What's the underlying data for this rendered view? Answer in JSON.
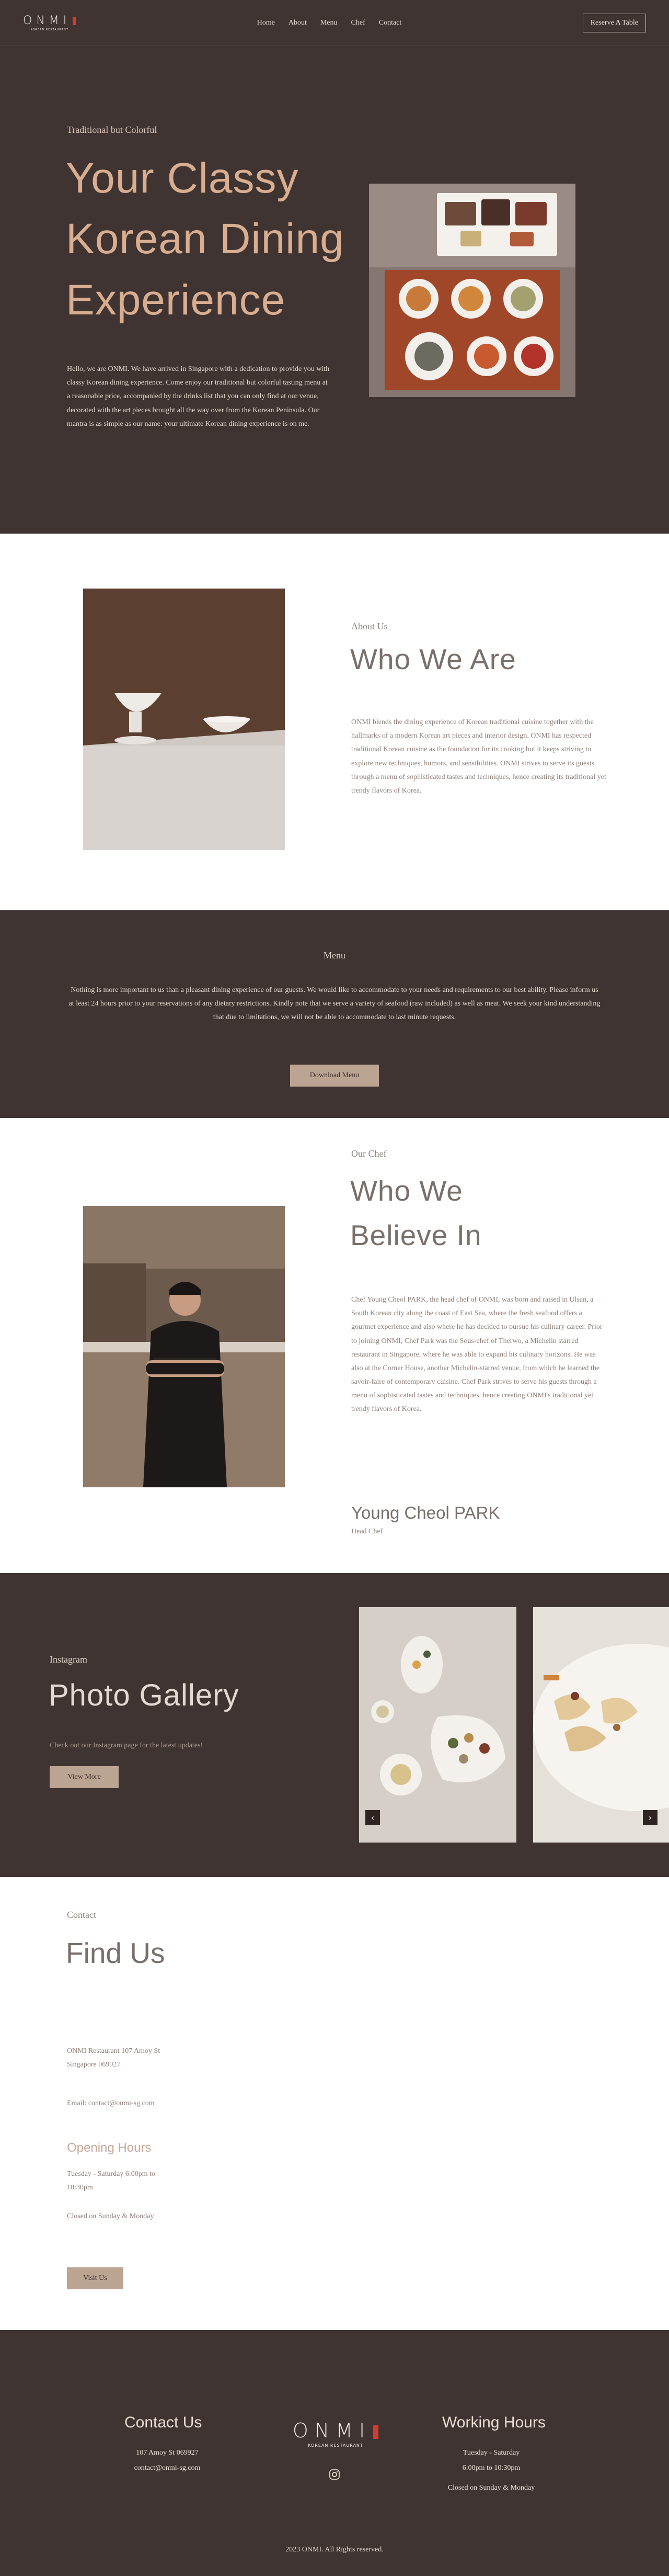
{
  "nav": {
    "logo_text": "ONMI",
    "logo_sub": "KOREAN RESTAURANT",
    "links": [
      "Home",
      "About",
      "Menu",
      "Chef",
      "Contact"
    ],
    "reserve_label": "Reserve A Table"
  },
  "hero": {
    "eyebrow": "Traditional but Colorful",
    "title": "Your Classy Korean Dining Experience",
    "text": "Hello, we are ONMI. We have arrived in Singapore with a dedication to provide you with classy Korean dining experience. Come enjoy our traditional but colorful tasting menu at a reasonable price, accompanied by the drinks list that you can only find at our venue, decorated with the art pieces brought all the way over from the Korean Peninsula. Our mantra is as simple as our name: your ultimate Korean dining experience is on me."
  },
  "about": {
    "eyebrow": "About Us",
    "title": "Who We Are",
    "text": "ONMI blends the dining experience of Korean traditional cuisine together with the hallmarks of a modern Korean art pieces and interior design. ONMI has respected traditional Korean cuisine as the foundation for its cooking but it keeps striving to explore new techniques, humors, and sensibilities. ONMI strives to serve its guests through a menu of sophisticated tastes and techniques, hence creating its traditional yet trendy flavors of Korea."
  },
  "menu": {
    "heading": "Menu",
    "text": "Nothing is more important to us than a pleasant dining experience of our guests. We would like to accommodate to your needs and requirements to our best ability. Please inform us at least 24 hours prior to your reservations of any dietary restrictions. Kindly note that we serve a variety of seafood (raw included) as well as meat. We seek your kind understanding that due to limitations, we will not be able to accommodate to last minute requests.",
    "button": "Download Menu"
  },
  "chef": {
    "eyebrow": "Our Chef",
    "title": "Who We Believe In",
    "text": "Chef Young Cheol PARK, the head chef of ONMI, was born and raised in Ulsan, a South Korean city along the coast of East Sea, where the fresh seafood offers a gourmet experience and also where he has decided to pursue his culinary career. Prior to joining ONMI, Chef Park was the Sous-chef of Therwo, a Michelin starred restaurant in Singapore, where he was able to expand his culinary horizons. He was also at the Corner House, another Michelin-starred venue, from which he learned the savoir-faire of contemporary cuisine. Chef Park strives to serve his guests through a menu of sophisticated tastes and techniques, hence creating ONMI's traditional yet trendy flavors of Korea.",
    "name": "Young Cheol PARK",
    "role": "Head Chef"
  },
  "gallery": {
    "eyebrow": "Instagram",
    "title": "Photo Gallery",
    "subtitle": "Check out our Instagram page for the latest updates!",
    "button": "View More"
  },
  "contact": {
    "eyebrow": "Contact",
    "title": "Find Us",
    "address": "ONMI Restaurant 107 Amoy St Singapore 069927",
    "email": "Email: contact@onmi-sg.com",
    "hours_title": "Opening Hours",
    "days": "Tuesday - Saturday 6:00pm to 10:30pm",
    "closed": "Closed on Sunday & Monday",
    "button": "Visit Us"
  },
  "footer": {
    "contact_title": "Contact Us",
    "address": "107 Amoy St 069927",
    "email": "contact@onmi-sg.com",
    "logo_text": "ONMI",
    "logo_sub": "KOREAN RESTAURANT",
    "hours_title": "Working Hours",
    "days": "Tuesday - Saturday",
    "time": "6:00pm to 10:30pm",
    "closed": "Closed on Sunday & Monday",
    "copyright": "2023 ONMI. All Rights reserved."
  },
  "colors": {
    "dark_bg": "#3f3431",
    "accent_tan": "#bca493",
    "logo_red": "#d23a32",
    "heading_peach": "#d8ad90"
  },
  "icons": [
    "instagram-icon",
    "chevron-left-icon",
    "chevron-right-icon"
  ]
}
